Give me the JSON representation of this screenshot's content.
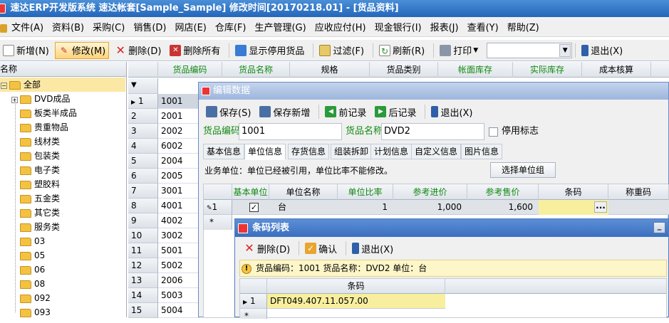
{
  "window_title": "速达ERP开发版系统  速达帐套[Sample_Sample] 修改时间[20170218.01] - [货品资料]",
  "menu": [
    "文件(A)",
    "资料(B)",
    "采购(C)",
    "销售(D)",
    "网店(E)",
    "仓库(F)",
    "生产管理(G)",
    "应收应付(H)",
    "现金银行(I)",
    "报表(J)",
    "查看(Y)",
    "帮助(Z)"
  ],
  "toolbar": {
    "new": "新增(N)",
    "edit": "修改(M)",
    "delete": "删除(D)",
    "delete_all": "删除所有",
    "show_disabled": "显示停用货品",
    "filter": "过滤(F)",
    "refresh": "刷新(R)",
    "print": "打印",
    "search_value": "",
    "exit": "退出(X)"
  },
  "tree": {
    "header": "名称",
    "root": "全部",
    "items": [
      "DVD成品",
      "板类半成品",
      "贵重物品",
      "线材类",
      "包装类",
      "电子类",
      "塑胶料",
      "五金类",
      "其它类",
      "服务类",
      "03",
      "05",
      "06",
      "08",
      "092",
      "093"
    ]
  },
  "grid": {
    "columns": [
      "货品编码",
      "货品名称",
      "规格",
      "货品类别",
      "帐面库存",
      "实际库存",
      "成本核算"
    ],
    "filter_icon": "▼",
    "rows": [
      {
        "n": "1",
        "code": "1001"
      },
      {
        "n": "2",
        "code": "2001"
      },
      {
        "n": "3",
        "code": "2002"
      },
      {
        "n": "4",
        "code": "6002"
      },
      {
        "n": "5",
        "code": "2004"
      },
      {
        "n": "6",
        "code": "2005"
      },
      {
        "n": "7",
        "code": "3001"
      },
      {
        "n": "8",
        "code": "4001"
      },
      {
        "n": "9",
        "code": "4002"
      },
      {
        "n": "10",
        "code": "3002"
      },
      {
        "n": "11",
        "code": "5001"
      },
      {
        "n": "12",
        "code": "5002"
      },
      {
        "n": "13",
        "code": "2006"
      },
      {
        "n": "14",
        "code": "5003"
      },
      {
        "n": "15",
        "code": "5004"
      }
    ]
  },
  "edit_dialog": {
    "title": "编辑数据",
    "save": "保存(S)",
    "save_new": "保存新增",
    "prev": "前记录",
    "next": "后记录",
    "exit": "退出(X)",
    "code_label": "货品编码",
    "code_value": "1001",
    "name_label": "货品名称",
    "name_value": "DVD2",
    "disabled_label": "停用标志",
    "tabs": [
      "基本信息",
      "单位信息",
      "存货信息",
      "组装拆卸",
      "计划信息",
      "自定义信息",
      "图片信息"
    ],
    "notice": "业务单位：单位已经被引用，单位比率不能修改。",
    "select_unit_group": "选择单位组",
    "unit_columns": [
      "基本单位",
      "单位名称",
      "单位比率",
      "参考进价",
      "参考售价",
      "条码",
      "称重码"
    ],
    "unit_row": {
      "n": "1",
      "unit": "台",
      "ratio": "1",
      "cost": "1,000",
      "price": "1,600",
      "barcode": "",
      "ellipsis": "..."
    },
    "new_row_marker": "*"
  },
  "barcode_dialog": {
    "title": "条码列表",
    "delete": "删除(D)",
    "confirm": "确认",
    "exit": "退出(X)",
    "info": "货品编码：1001  货品名称：DVD2  单位：台",
    "column": "条码",
    "rows": [
      {
        "n": "1",
        "code": "DFT049.407.11.057.00"
      }
    ],
    "new_row_marker": "*",
    "minimize": "_"
  }
}
